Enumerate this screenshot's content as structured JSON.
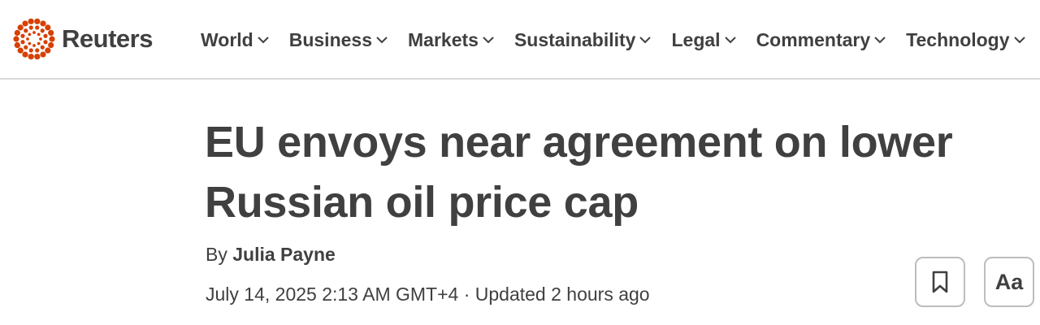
{
  "brand": {
    "name": "Reuters",
    "color": "#d64000",
    "logo_icon": "reuters-dot-ring-icon"
  },
  "nav": {
    "items": [
      {
        "label": "World"
      },
      {
        "label": "Business"
      },
      {
        "label": "Markets"
      },
      {
        "label": "Sustainability"
      },
      {
        "label": "Legal"
      },
      {
        "label": "Commentary"
      },
      {
        "label": "Technology"
      }
    ],
    "chevron_icon": "chevron-down-icon"
  },
  "article": {
    "headline": "EU envoys near agreement on lower Russian oil price cap",
    "byline_prefix": "By",
    "author": "Julia Payne",
    "published": "July 14, 2025 2:13 AM GMT+4",
    "separator": "·",
    "updated": "Updated 2 hours ago"
  },
  "tools": {
    "bookmark_icon": "bookmark-icon",
    "font_size_label": "Aa"
  },
  "colors": {
    "text": "#404040",
    "divider": "#d9d9d9",
    "button_border": "#bdbdbd"
  }
}
